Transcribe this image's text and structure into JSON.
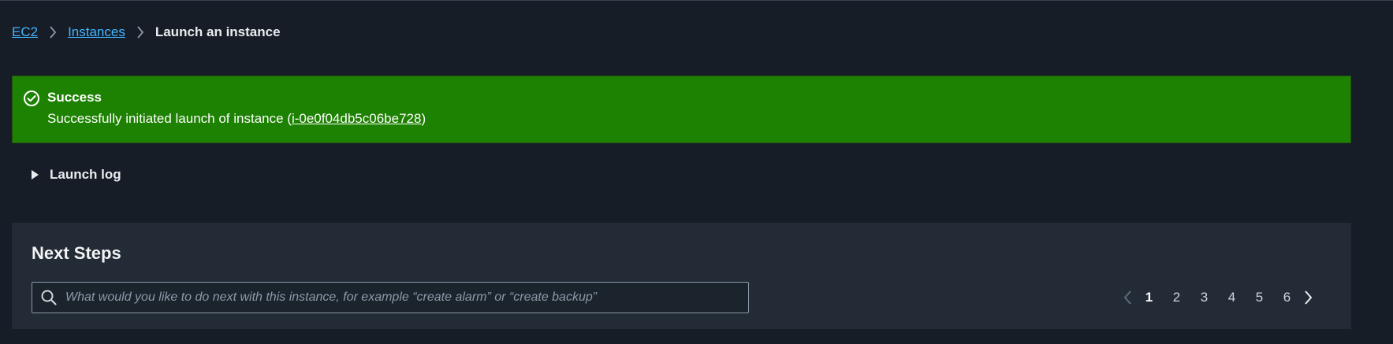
{
  "breadcrumb": {
    "items": [
      {
        "label": "EC2"
      },
      {
        "label": "Instances"
      }
    ],
    "current": "Launch an instance"
  },
  "banner": {
    "status": "success",
    "color": "#1d8102",
    "title": "Success",
    "message_prefix": "Successfully initiated launch of instance (",
    "instance_id": "i-0e0f04db5c06be728",
    "message_suffix": ")"
  },
  "launch_log": {
    "label": "Launch log",
    "expanded": false
  },
  "next_steps": {
    "title": "Next Steps",
    "search": {
      "placeholder": "What would you like to do next with this instance, for example “create alarm” or “create backup”",
      "value": ""
    },
    "pagination": {
      "pages": [
        "1",
        "2",
        "3",
        "4",
        "5",
        "6"
      ],
      "current": "1"
    }
  }
}
